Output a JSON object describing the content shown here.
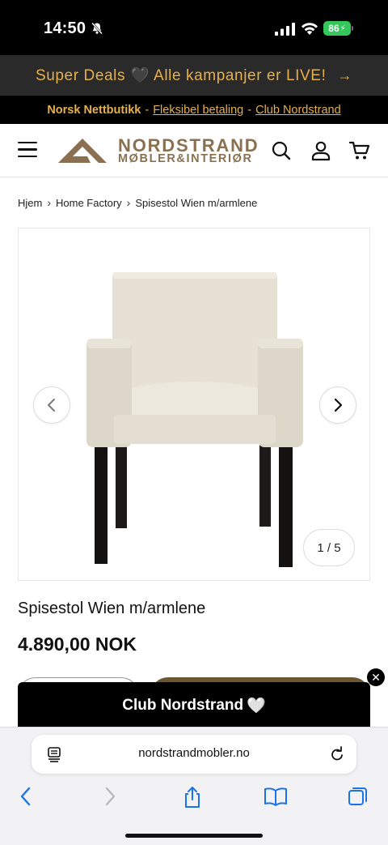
{
  "status": {
    "time": "14:50",
    "battery": "86"
  },
  "promo": {
    "text": "Super Deals 🖤 Alle kampanjer er LIVE!",
    "arrow": "→"
  },
  "infobar": {
    "store": "Norsk Nettbutikk",
    "sep": "-",
    "payment": "Fleksibel betaling",
    "club": "Club Nordstrand"
  },
  "header": {
    "logo_line1": "NORDSTRAND",
    "logo_line2": "MØBLER&INTERIØR"
  },
  "breadcrumb": [
    "Hjem",
    "Home Factory",
    "Spisestol Wien m/armlene"
  ],
  "gallery": {
    "counter": "1 / 5"
  },
  "product": {
    "title": "Spisestol Wien m/armlene",
    "price": "4.890,00 NOK"
  },
  "club_banner": {
    "label": "Club Nordstrand",
    "heart": "🤍"
  },
  "browser": {
    "url": "nordstrandmobler.no"
  },
  "colors": {
    "accent": "#e6b04a",
    "brand": "#8a7050"
  }
}
